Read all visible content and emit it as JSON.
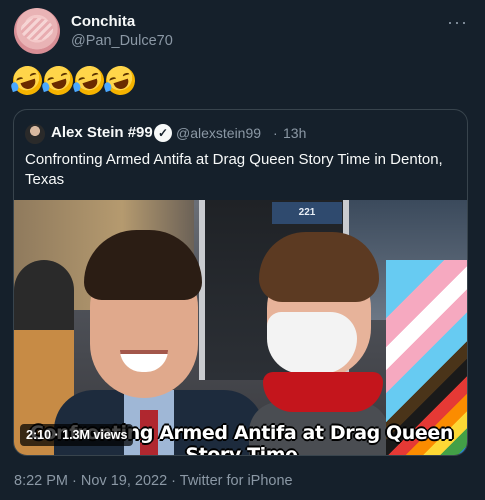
{
  "tweet": {
    "author": {
      "display_name": "Conchita",
      "handle": "@Pan_Dulce70",
      "avatar": "concha-pastry-avatar"
    },
    "more_icon": "ellipsis-icon",
    "more_symbol": "···",
    "emojis": [
      "rolling-on-floor-laughing",
      "rolling-on-floor-laughing",
      "rolling-on-floor-laughing",
      "rolling-on-floor-laughing"
    ],
    "timestamp": "8:22 PM · Nov 19, 2022 ·",
    "source": "Twitter for iPhone"
  },
  "quoted_tweet": {
    "author": {
      "display_name": "Alex Stein #99",
      "handle": "@alexstein99",
      "verified_icon": "verified-badge-icon"
    },
    "separator": "·",
    "verified_symbol": "✓",
    "time": "13h",
    "text": "Confronting Armed Antifa at Drag Queen Story Time in Denton, Texas",
    "media": {
      "type": "video",
      "building_sign": "221",
      "caption": "Confronting Armed Antifa at Drag Queen Story Time",
      "badge": "2:10 · 1.3M views"
    }
  },
  "colors": {
    "background": "#15202b",
    "primary_text": "#f7f9f9",
    "secondary_text": "#8b98a5",
    "border": "#38444d"
  }
}
